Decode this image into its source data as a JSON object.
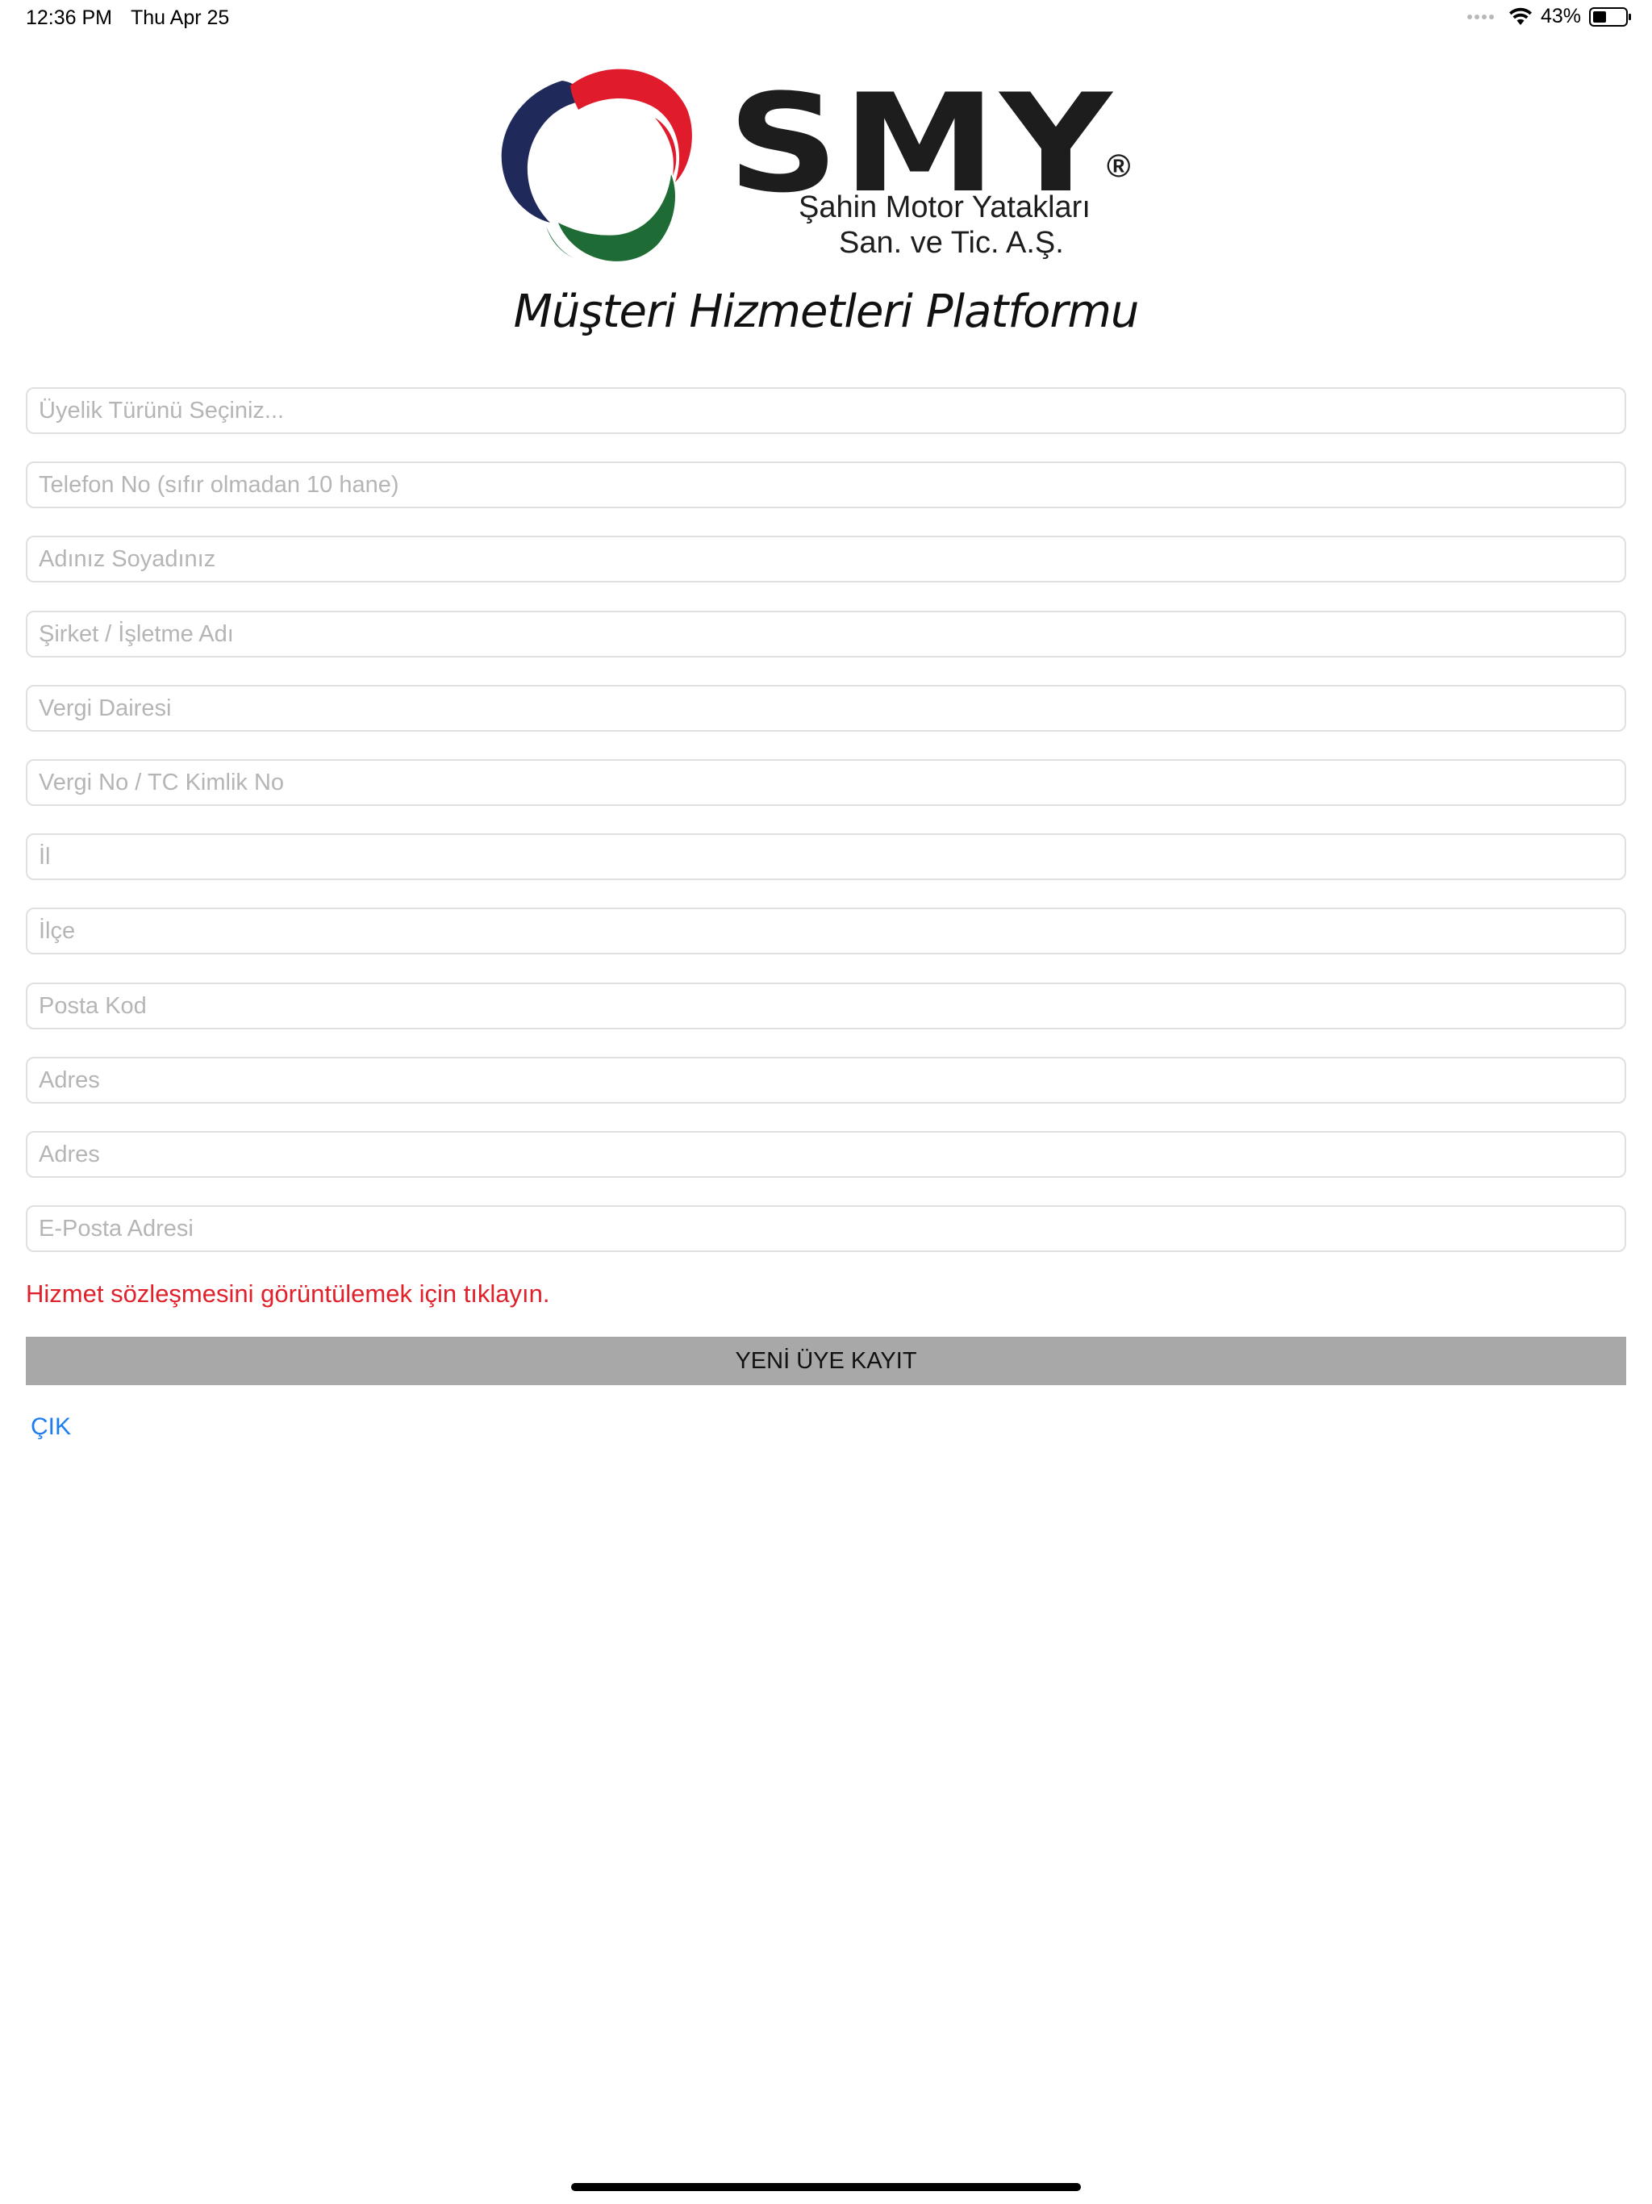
{
  "status_bar": {
    "time": "12:36 PM",
    "date": "Thu Apr 25",
    "battery_pct": "43%",
    "battery_level": 0.43,
    "icons": [
      "cellular-dots-icon",
      "wifi-icon",
      "battery-icon"
    ]
  },
  "brand": {
    "wordmark": "SMY",
    "registered": "®",
    "line1": "Şahin Motor Yatakları",
    "line2": "San. ve Tic. A.Ş.",
    "colors": {
      "navy": "#1f2a5a",
      "red": "#e01b2c",
      "green": "#1e6b35",
      "text": "#1d1d1d"
    }
  },
  "platform_title": "Müşteri Hizmetleri Platformu",
  "form": {
    "fields": [
      {
        "name": "membership-type-select",
        "placeholder": "Üyelik Türünü Seçiniz...",
        "value": ""
      },
      {
        "name": "phone-input",
        "placeholder": "Telefon No (sıfır olmadan 10 hane)",
        "value": ""
      },
      {
        "name": "full-name-input",
        "placeholder": "Adınız Soyadınız",
        "value": ""
      },
      {
        "name": "company-name-input",
        "placeholder": "Şirket / İşletme Adı",
        "value": ""
      },
      {
        "name": "tax-office-input",
        "placeholder": "Vergi Dairesi",
        "value": ""
      },
      {
        "name": "tax-id-input",
        "placeholder": "Vergi No / TC Kimlik No",
        "value": ""
      },
      {
        "name": "province-input",
        "placeholder": "İl",
        "value": ""
      },
      {
        "name": "district-input",
        "placeholder": "İlçe",
        "value": ""
      },
      {
        "name": "postal-code-input",
        "placeholder": "Posta Kod",
        "value": ""
      },
      {
        "name": "address-1-input",
        "placeholder": "Adres",
        "value": ""
      },
      {
        "name": "address-2-input",
        "placeholder": "Adres",
        "value": ""
      },
      {
        "name": "email-input",
        "placeholder": "E-Posta Adresi",
        "value": ""
      }
    ],
    "agreement_link": "Hizmet sözleşmesini görüntülemek için tıklayın.",
    "register_label": "YENİ ÜYE KAYIT",
    "exit_label": "ÇIK"
  }
}
